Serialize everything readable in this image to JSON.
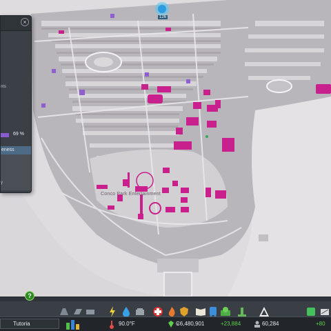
{
  "panel": {
    "close_symbol": "×",
    "cut_text_1": "nts",
    "progress_value": 0.69,
    "progress_label": "69 %",
    "tab_label": "eness",
    "cut_text_2": "y"
  },
  "map": {
    "district_label": "Conco Park Entertainment",
    "marker_badge": "126"
  },
  "toolbar": {
    "help_symbol": "?",
    "city_name": "Tutoria",
    "temperature": "90.0°F",
    "money": "₢6,480,901",
    "income": "+23,884",
    "population": "60,284",
    "population_change": "+80"
  },
  "colors": {
    "panel_bg": "#3b4046",
    "tab_bg": "#4d6a86",
    "progress_fill": "#8b5bd3",
    "highlight_buildings": "#c8208c",
    "money_green": "#5fcf4b"
  },
  "icons": [
    "road-icon",
    "zoning-icon",
    "district-icon",
    "electricity-icon",
    "water-icon",
    "garbage-icon",
    "healthcare-icon",
    "fire-icon",
    "police-icon",
    "education-icon",
    "transport-icon",
    "beautification-icon",
    "monument-icon",
    "wonders-icon",
    "landscaping-icon",
    "bulldozer-icon"
  ]
}
